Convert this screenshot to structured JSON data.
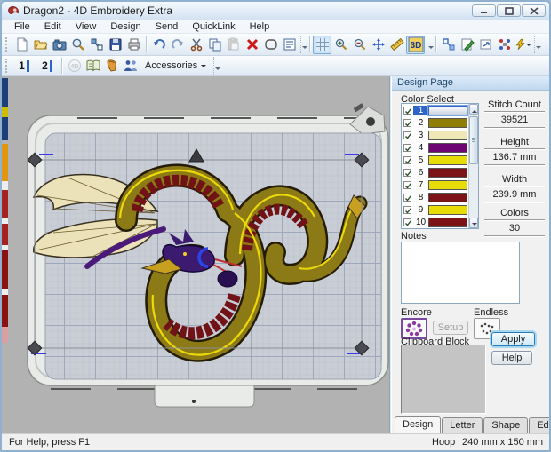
{
  "window": {
    "title": "Dragon2 - 4D Embroidery Extra"
  },
  "menu": {
    "items": [
      "File",
      "Edit",
      "View",
      "Design",
      "Send",
      "QuickLink",
      "Help"
    ]
  },
  "toolbar_main": {
    "icons": [
      "new-icon",
      "open-icon",
      "insert-picture-icon",
      "view-magnifier-icon",
      "transfer-icon",
      "save-icon",
      "print-icon",
      "undo-icon",
      "redo-icon",
      "cut-icon",
      "copy-icon",
      "paste-icon",
      "delete-icon",
      "select-box-icon",
      "design-notes-icon",
      "grid-icon",
      "zoom-in-icon",
      "zoom-out-icon",
      "pan-icon",
      "measure-icon",
      "3d-view-icon",
      "block-select-icon",
      "edit-design-icon",
      "modify-block-icon",
      "color-resequence-icon",
      "wizard-icon"
    ],
    "labels": {
      "three_d": "3D"
    }
  },
  "toolbar_secondary": {
    "marker1": "1",
    "marker2": "2",
    "logo": "4D",
    "accessories_label": "Accessories",
    "icons": [
      "stitch-marker-1",
      "stitch-marker-2",
      "4d-logo-disabled",
      "reference-book-icon",
      "glove-icon",
      "people-icon",
      "accessories-dropdown"
    ]
  },
  "design_panel": {
    "header": "Design Page",
    "color_select": {
      "label": "Color Select",
      "rows": [
        {
          "num": "1",
          "color": "#f0f3f8",
          "checked": true,
          "selected": true
        },
        {
          "num": "2",
          "color": "#8f7d06",
          "checked": true,
          "selected": false
        },
        {
          "num": "3",
          "color": "#efe7b6",
          "checked": true,
          "selected": false
        },
        {
          "num": "4",
          "color": "#6d0672",
          "checked": true,
          "selected": false
        },
        {
          "num": "5",
          "color": "#e8dc07",
          "checked": true,
          "selected": false
        },
        {
          "num": "6",
          "color": "#7c1417",
          "checked": true,
          "selected": false
        },
        {
          "num": "7",
          "color": "#e8dc07",
          "checked": true,
          "selected": false
        },
        {
          "num": "8",
          "color": "#7c1417",
          "checked": true,
          "selected": false
        },
        {
          "num": "9",
          "color": "#e8dc07",
          "checked": true,
          "selected": false
        },
        {
          "num": "10",
          "color": "#7c1417",
          "checked": true,
          "selected": false
        }
      ]
    },
    "stats": [
      {
        "label": "Stitch Count",
        "value": "39521"
      },
      {
        "label": "Height",
        "value": "136.7 mm"
      },
      {
        "label": "Width",
        "value": "239.9 mm"
      },
      {
        "label": "Colors",
        "value": "30"
      }
    ],
    "notes_label": "Notes",
    "notes_value": "",
    "encore_label": "Encore",
    "setup_label": "Setup",
    "endless_label": "Endless",
    "clipboard_label": "Clipboard Block",
    "apply_label": "Apply",
    "help_label": "Help",
    "tabs": [
      {
        "label": "Design",
        "active": true
      },
      {
        "label": "Letter",
        "active": false
      },
      {
        "label": "Shape",
        "active": false
      },
      {
        "label": "Edit",
        "active": false
      }
    ]
  },
  "status_bar": {
    "help_text": "For Help, press F1",
    "hoop_label": "Hoop",
    "hoop_value": "240 mm x 150 mm"
  },
  "colors": {
    "selection_accent": "#2e64c8",
    "canvas_bg": "#b2b2b2",
    "hoop_frame": "#e9ebe9",
    "grid_bg": "#c9cdd5"
  }
}
